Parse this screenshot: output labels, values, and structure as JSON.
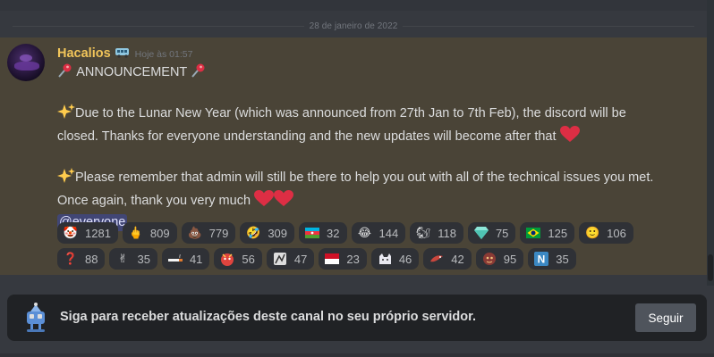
{
  "date_divider": "28 de janeiro de 2022",
  "message": {
    "author": "Hacalios",
    "timestamp": "Hoje às 01:57",
    "title": "ANNOUNCEMENT",
    "paragraph1": "Due to the Lunar New Year (which was announced from 27th Jan to 7th Feb), the discord will be closed. Thanks for everyone understanding and the new updates will become after that",
    "paragraph2": "Please remember that admin will still be there to help you out with all of the technical issues you met. Once again, thank you very much",
    "mention": "@everyone"
  },
  "reactions": [
    {
      "emoji": "clown-face",
      "glyph": "🤡",
      "count": "1281"
    },
    {
      "emoji": "middle-finger",
      "glyph": "🖕",
      "count": "809"
    },
    {
      "emoji": "pile-of-poo",
      "glyph": "💩",
      "count": "779"
    },
    {
      "emoji": "rolling-laughing",
      "glyph": "🤣",
      "count": "309"
    },
    {
      "emoji": "flag-azerbaijan",
      "glyph": "",
      "count": "32"
    },
    {
      "emoji": "tears-of-joy",
      "glyph": "😂",
      "count": "144"
    },
    {
      "emoji": "squirrel",
      "glyph": "🐿",
      "count": "118"
    },
    {
      "emoji": "gem",
      "glyph": "",
      "count": "75"
    },
    {
      "emoji": "flag-brazil",
      "glyph": "",
      "count": "125"
    },
    {
      "emoji": "grimace-face",
      "glyph": "🙂",
      "count": "106"
    },
    {
      "emoji": "question-mark",
      "glyph": "❓",
      "count": "88"
    },
    {
      "emoji": "victory-hand",
      "glyph": "✌",
      "count": "35"
    },
    {
      "emoji": "cigarette",
      "glyph": "",
      "count": "41"
    },
    {
      "emoji": "red-face",
      "glyph": "",
      "count": "56"
    },
    {
      "emoji": "custom-sticker",
      "glyph": "",
      "count": "47"
    },
    {
      "emoji": "flag-indonesia",
      "glyph": "",
      "count": "23"
    },
    {
      "emoji": "custom-cat",
      "glyph": "",
      "count": "46"
    },
    {
      "emoji": "custom-bird",
      "glyph": "",
      "count": "42"
    },
    {
      "emoji": "custom-creature",
      "glyph": "",
      "count": "95"
    },
    {
      "emoji": "letter-n",
      "glyph": "N",
      "count": "35"
    }
  ],
  "follow_bar": {
    "text": "Siga para receber atualizações deste canal no seu próprio servidor.",
    "button": "Seguir"
  },
  "colors": {
    "username": "#f0c45a",
    "highlight_bg": "#4a4437",
    "mention_bg": "#414675",
    "heart": "#dd2e44"
  }
}
